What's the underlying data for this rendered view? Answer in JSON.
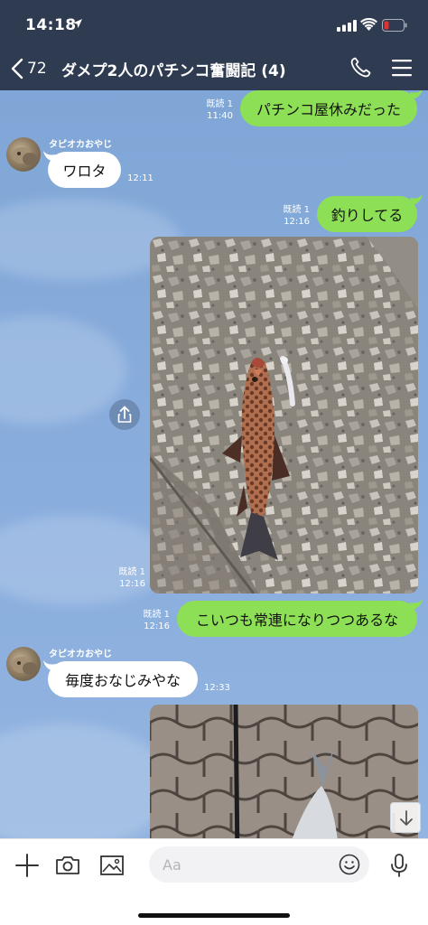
{
  "status_bar": {
    "time": "14:18"
  },
  "header": {
    "back_count": "72",
    "title": "ダメプ2人のパチンコ奮闘記 (4)"
  },
  "messages": [
    {
      "type": "sent_text",
      "text": "パチンコ屋休みだった",
      "read": "既読 1",
      "time": "11:40"
    },
    {
      "type": "received_text",
      "sender": "タピオカおやじ",
      "text": "ワロタ",
      "time": "12:11"
    },
    {
      "type": "sent_text",
      "text": "釣りしてる",
      "read": "既読 1",
      "time": "12:16"
    },
    {
      "type": "sent_photo",
      "read": "既読 1",
      "time": "12:16"
    },
    {
      "type": "sent_text",
      "text": "こいつも常連になりつつあるな",
      "read": "既読 1",
      "time": "12:16"
    },
    {
      "type": "received_text",
      "sender": "タピオカおやじ",
      "text": "毎度おなじみやな",
      "time": "12:33"
    },
    {
      "type": "sent_photo"
    }
  ],
  "input": {
    "placeholder": "Aa"
  },
  "icons": {
    "back": "chevron-left-icon",
    "call": "phone-icon",
    "menu": "menu-icon",
    "share": "share-icon",
    "scroll": "arrow-down-icon",
    "plus": "plus-icon",
    "camera": "camera-icon",
    "image": "image-icon",
    "emoji": "emoji-icon",
    "mic": "microphone-icon"
  },
  "colors": {
    "header_bg": "#2f3b51",
    "sent_bubble": "#8de055",
    "received_bubble": "#ffffff",
    "battery_low": "#e03030"
  }
}
